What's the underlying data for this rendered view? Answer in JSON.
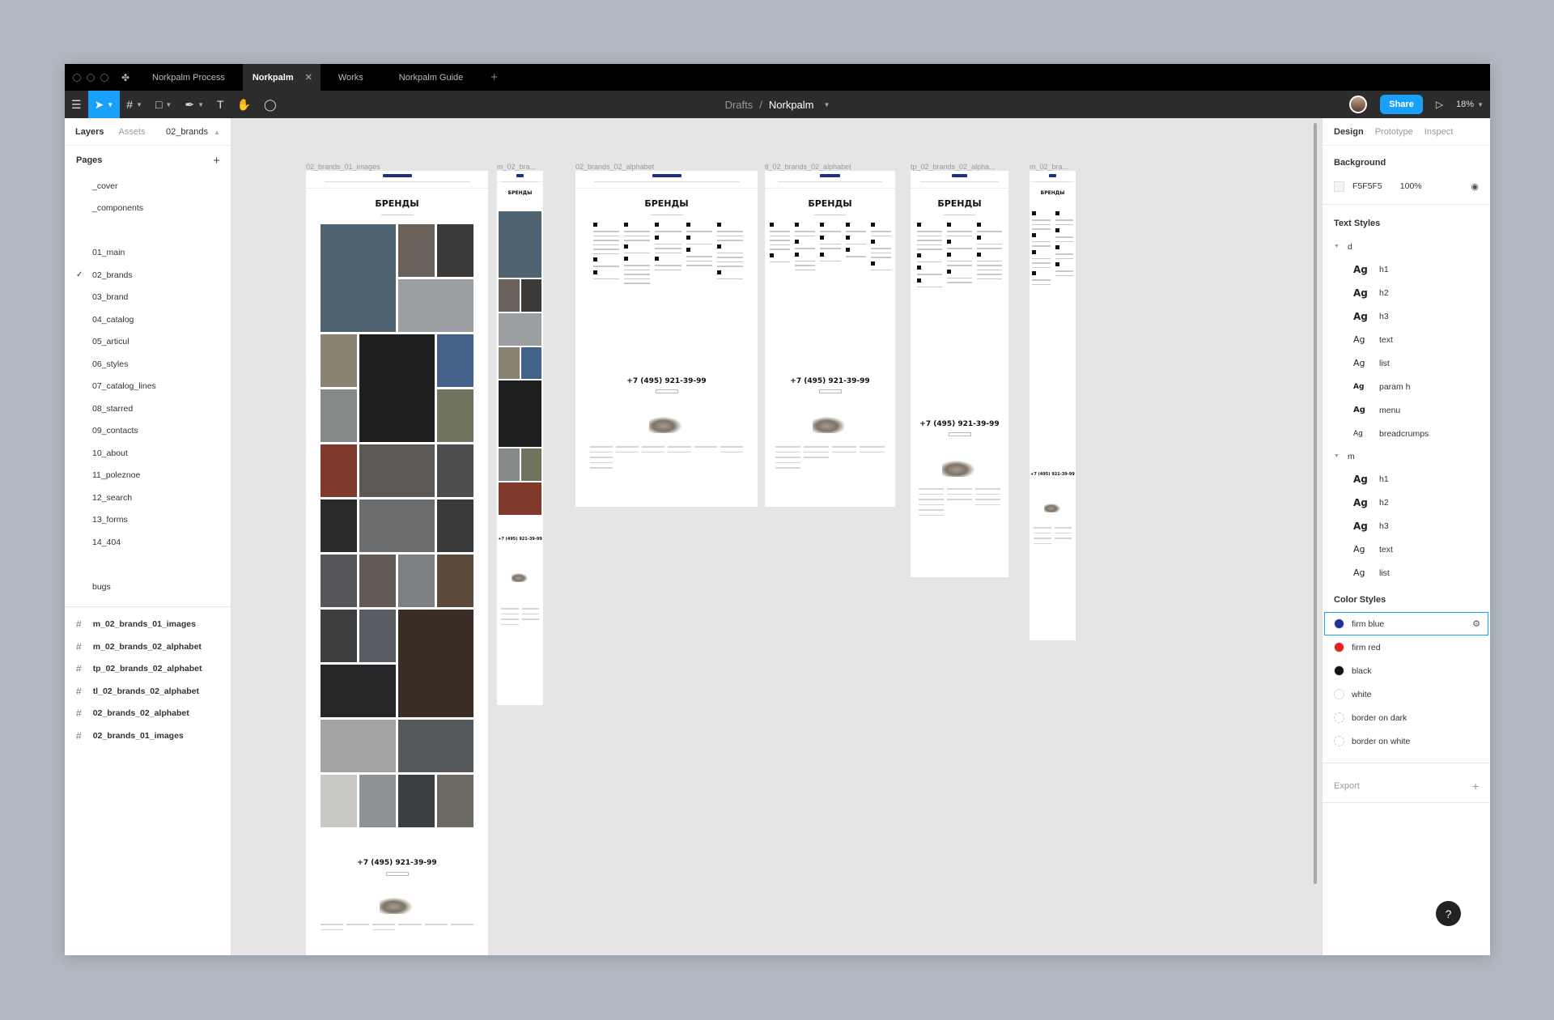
{
  "tabs": [
    {
      "label": "Norkpalm Process",
      "active": false
    },
    {
      "label": "Norkpalm",
      "active": true
    },
    {
      "label": "Works",
      "active": false
    },
    {
      "label": "Norkpalm Guide",
      "active": false
    }
  ],
  "toolbar": {
    "breadcrumb_root": "Drafts",
    "breadcrumb_sep": "/",
    "file_name": "Norkpalm",
    "share_label": "Share",
    "zoom": "18%"
  },
  "left_panel": {
    "tab_layers": "Layers",
    "tab_assets": "Assets",
    "current_page": "02_brands",
    "pages_title": "Pages",
    "pages": [
      "_cover",
      "_components",
      "",
      "01_main",
      "02_brands",
      "03_brand",
      "04_catalog",
      "05_articul",
      "06_styles",
      "07_catalog_lines",
      "08_starred",
      "09_contacts",
      "10_about",
      "11_poleznoe",
      "12_search",
      "13_forms",
      "14_404",
      "",
      "bugs"
    ],
    "selected_page": "02_brands",
    "frames": [
      "m_02_brands_01_images",
      "m_02_brands_02_alphabet",
      "tp_02_brands_02_alphabet",
      "tl_02_brands_02_alphabet",
      "02_brands_02_alphabet",
      "02_brands_01_images"
    ]
  },
  "canvas": {
    "frame_labels": [
      "02_brands_01_images",
      "m_02_bra...",
      "02_brands_02_alphabet",
      "tl_02_brands_02_alphabet",
      "tp_02_brands_02_alpha...",
      "m_02_bra..."
    ],
    "page_heading": "БРЕНДЫ",
    "phone": "+7 (495) 921-39-99"
  },
  "right_panel": {
    "tab_design": "Design",
    "tab_prototype": "Prototype",
    "tab_inspect": "Inspect",
    "background_title": "Background",
    "background_hex": "F5F5F5",
    "background_opacity": "100%",
    "text_styles_title": "Text Styles",
    "text_groups": [
      {
        "name": "d",
        "styles": [
          "h1",
          "h2",
          "h3",
          "text",
          "list",
          "param h",
          "menu",
          "breadcrumps"
        ]
      },
      {
        "name": "m",
        "styles": [
          "h1",
          "h2",
          "h3",
          "text",
          "list"
        ]
      }
    ],
    "ag_glyph": "Ag",
    "color_styles_title": "Color Styles",
    "colors": [
      {
        "name": "firm blue",
        "hex": "#1e3296"
      },
      {
        "name": "firm red",
        "hex": "#e2231a"
      },
      {
        "name": "black",
        "hex": "#111111"
      },
      {
        "name": "white",
        "hex": "#ffffff"
      },
      {
        "name": "border on dark",
        "hex": "#e8e8e8"
      },
      {
        "name": "border on white",
        "hex": "#e8e8e8"
      }
    ],
    "export_title": "Export",
    "help": "?"
  }
}
